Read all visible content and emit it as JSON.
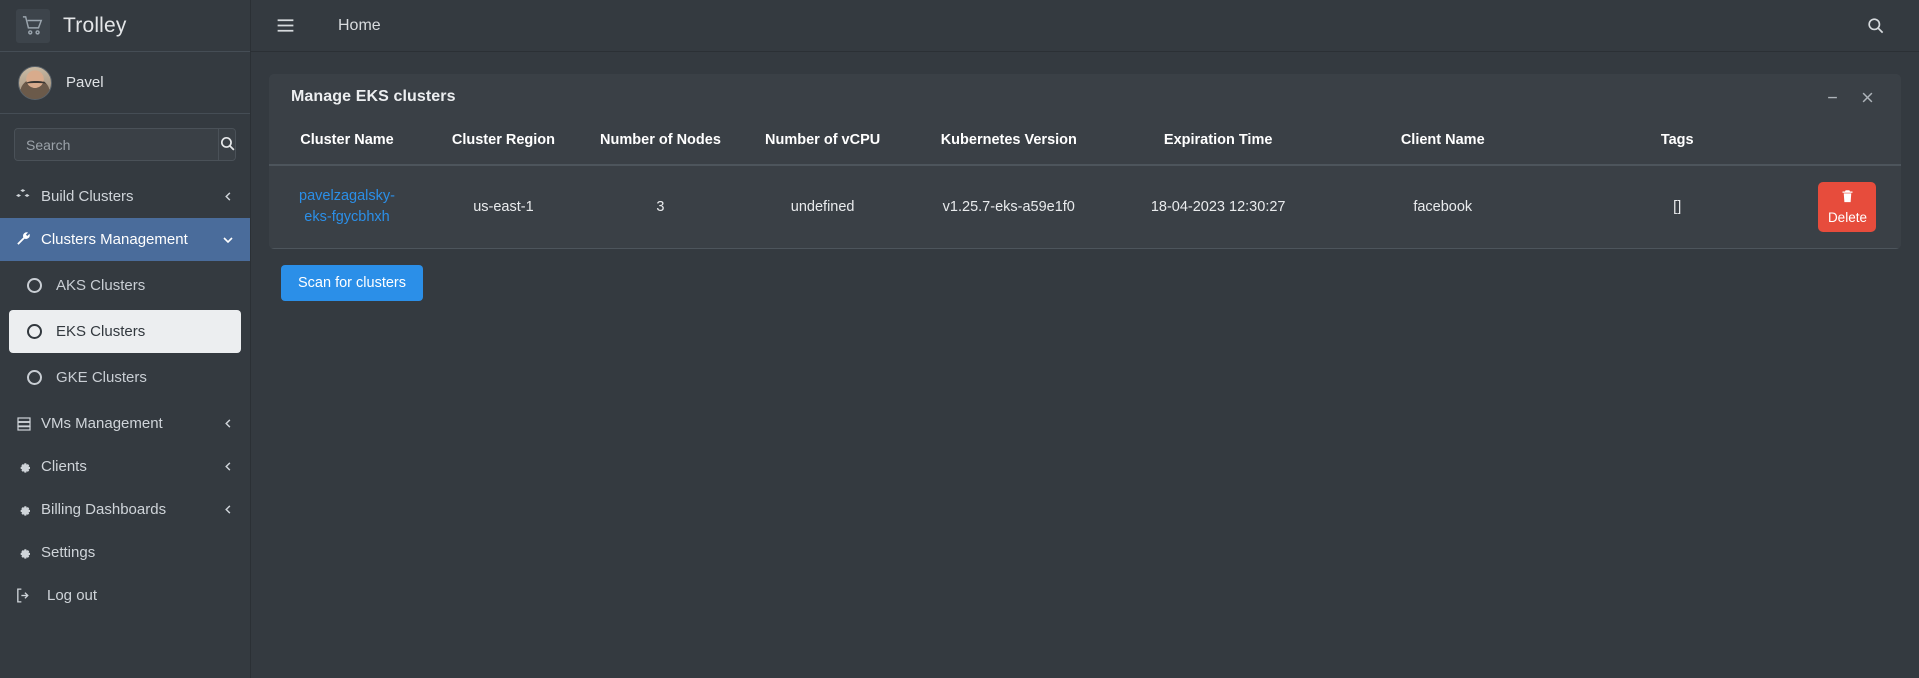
{
  "brand": {
    "name": "Trolley",
    "logo_icon": "shopping-cart-icon"
  },
  "user": {
    "name": "Pavel"
  },
  "search": {
    "placeholder": "Search",
    "value": "",
    "icon": "search-icon"
  },
  "sidebar": {
    "items": [
      {
        "label": "Build Clusters",
        "icon": "cubes-icon",
        "chevron": "chevron-left-icon",
        "active": false
      },
      {
        "label": "Clusters Management",
        "icon": "wrench-icon",
        "chevron": "chevron-down-icon",
        "active": true
      }
    ],
    "sub_items": [
      {
        "label": "AKS Clusters",
        "icon": "circle-icon",
        "selected": false
      },
      {
        "label": "EKS Clusters",
        "icon": "circle-icon",
        "selected": true
      },
      {
        "label": "GKE Clusters",
        "icon": "circle-icon",
        "selected": false
      }
    ],
    "items_bottom": [
      {
        "label": "VMs Management",
        "icon": "server-icon",
        "chevron": "chevron-left-icon"
      },
      {
        "label": "Clients",
        "icon": "gear-icon",
        "chevron": "chevron-left-icon"
      },
      {
        "label": "Billing Dashboards",
        "icon": "gear-icon",
        "chevron": "chevron-left-icon"
      },
      {
        "label": "Settings",
        "icon": "gear-icon",
        "chevron": ""
      },
      {
        "label": "Log out",
        "icon": "sign-out-icon",
        "chevron": ""
      }
    ]
  },
  "topbar": {
    "menu_icon": "hamburger-icon",
    "title": "Home",
    "search_icon": "search-icon"
  },
  "panel": {
    "title": "Manage EKS clusters",
    "minimize_icon": "minimize-icon",
    "close_icon": "close-icon"
  },
  "table": {
    "headers": [
      "Cluster Name",
      "Cluster Region",
      "Number of Nodes",
      "Number of vCPU",
      "Kubernetes Version",
      "Expiration Time",
      "Client Name",
      "Tags"
    ],
    "rows": [
      {
        "cluster_name": "pavelzagalsky-eks-fgycbhxh",
        "cluster_region": "us-east-1",
        "number_of_nodes": "3",
        "number_of_vcpu": "undefined",
        "kubernetes_version": "v1.25.7-eks-a59e1f0",
        "expiration_time": "18-04-2023 12:30:27",
        "client_name": "facebook",
        "tags": "[]",
        "delete_label": "Delete",
        "delete_icon": "trash-icon"
      }
    ]
  },
  "actions": {
    "scan_label": "Scan for clusters"
  },
  "colors": {
    "accent_blue": "#2b8fe8",
    "active_nav": "#4a6c9b",
    "danger_red": "#e74c3c",
    "panel_bg": "#3a4046",
    "page_bg": "#343a40"
  }
}
